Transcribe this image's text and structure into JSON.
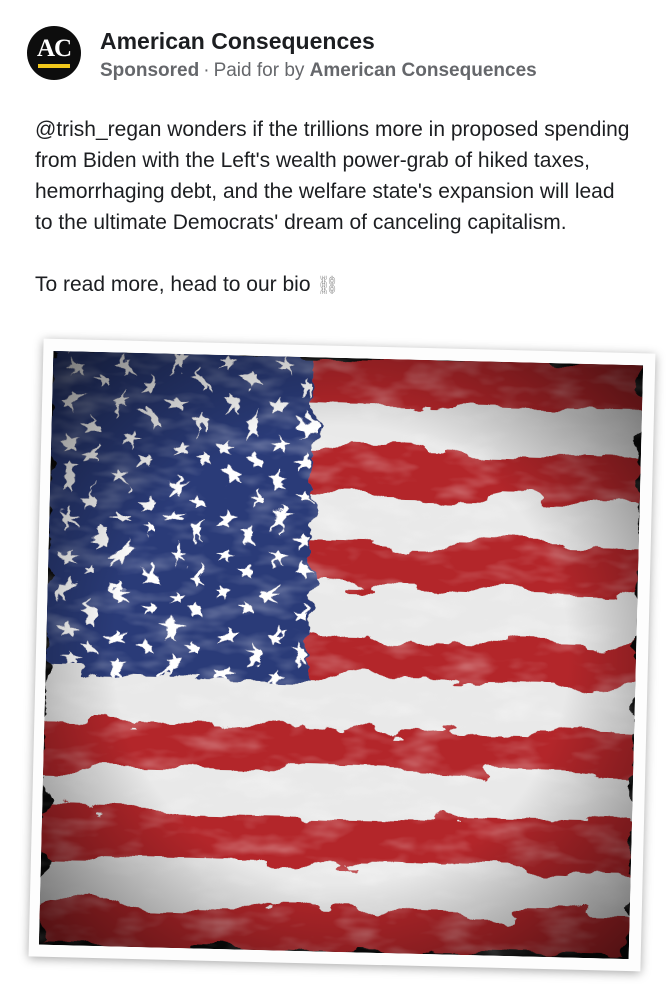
{
  "post": {
    "avatar_text": "AC",
    "page_name": "American Consequences",
    "sponsored_label": "Sponsored",
    "separator": "·",
    "paid_for_label": "Paid for by",
    "payer_name": "American Consequences",
    "body_paragraph_1": "@trish_regan wonders if the trillions more in proposed spending from Biden with the Left's wealth power-grab of hiked taxes, hemorrhaging debt, and the welfare state's expansion will lead to the ultimate Democrats' dream of canceling capitalism.",
    "body_paragraph_2": "To read more, head to our bio",
    "link_icon_glyph": "⛓",
    "image": {
      "icon": "smoky-american-flag-image"
    }
  },
  "colors": {
    "avatar_bg": "#0d0d0d",
    "avatar_accent": "#f2c81b",
    "text_primary": "#1c1e21",
    "text_secondary": "#65676b",
    "flag_red": "#b3262b",
    "flag_blue": "#2b3a78"
  }
}
